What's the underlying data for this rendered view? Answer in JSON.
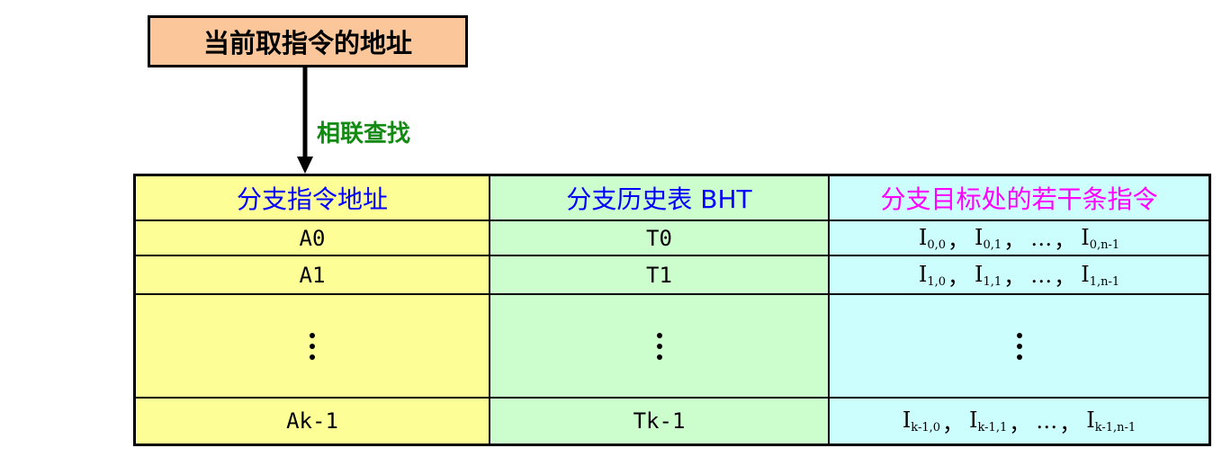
{
  "top_box": {
    "label": "当前取指令的地址"
  },
  "arrow_label": "相联查找",
  "headers": {
    "col1": "分支指令地址",
    "col2": "分支历史表 BHT",
    "col3": "分支目标处的若干条指令"
  },
  "rows": [
    {
      "addr": "A0",
      "bht": "T0",
      "instr": [
        {
          "base": "I",
          "sub": "0,0"
        },
        {
          "base": "I",
          "sub": "0,1"
        },
        {
          "base": "…"
        },
        {
          "base": "I",
          "sub": "0,n-1"
        }
      ]
    },
    {
      "addr": "A1",
      "bht": "T1",
      "instr": [
        {
          "base": "I",
          "sub": "1,0"
        },
        {
          "base": "I",
          "sub": "1,1"
        },
        {
          "base": "…"
        },
        {
          "base": "I",
          "sub": "1,n-1"
        }
      ]
    },
    {
      "addr": "⋮",
      "bht": "⋮",
      "instr": []
    },
    {
      "addr": "Ak-1",
      "bht": "Tk-1",
      "instr": [
        {
          "base": "I",
          "sub": "k-1,0"
        },
        {
          "base": "I",
          "sub": "k-1,1"
        },
        {
          "base": "…"
        },
        {
          "base": "I",
          "sub": "k-1,n-1"
        }
      ]
    }
  ],
  "colors": {
    "top_box": "#fbc79a",
    "col1": "#fefe96",
    "col2": "#ccfdcc",
    "col3": "#ccfefe",
    "header_blue": "#0000ff",
    "header_magenta": "#ff00ff",
    "arrow_label": "#138a13"
  }
}
